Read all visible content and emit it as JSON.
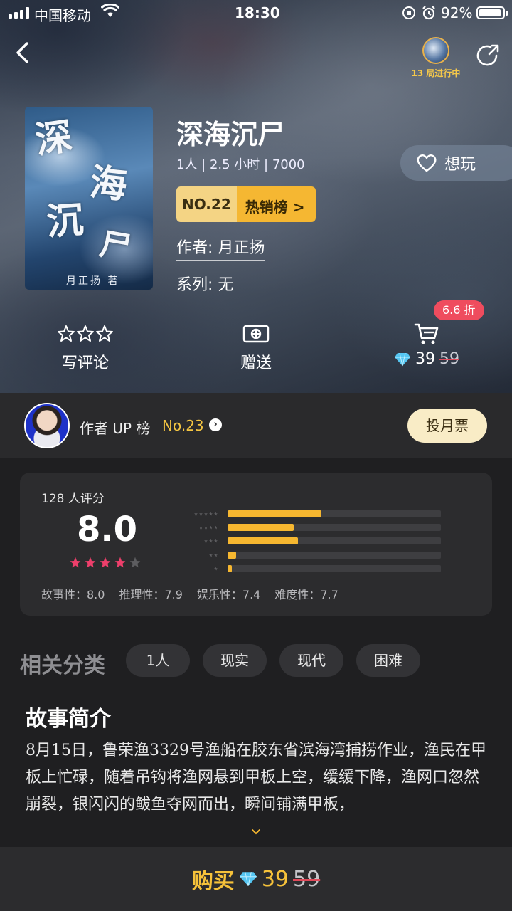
{
  "status_bar": {
    "carrier": "中国移动",
    "time": "18:30",
    "battery": "92%"
  },
  "live": {
    "text": "13 局进行中"
  },
  "game": {
    "title": "深海沉尸",
    "meta": "1人 | 2.5 小时 | 7000",
    "rank_no": "NO.22",
    "rank_label": "热销榜 >",
    "author": "作者: 月正扬",
    "series": "系列: 无",
    "want_label": "想玩",
    "cover_chars": [
      "深",
      "海",
      "沉",
      "尸"
    ],
    "cover_author": "月正扬 著"
  },
  "actions": {
    "review": "写评论",
    "gift": "赠送",
    "discount_badge": "6.6 折",
    "price": "39",
    "original_price": "59"
  },
  "author_up": {
    "label": "作者 UP 榜",
    "rank": "No.23",
    "vote_button": "投月票"
  },
  "rating": {
    "count": "128 人评分",
    "score": "8.0",
    "star_level": 4,
    "distribution": [
      {
        "stars": 5,
        "fraction": 0.44
      },
      {
        "stars": 4,
        "fraction": 0.31
      },
      {
        "stars": 3,
        "fraction": 0.33
      },
      {
        "stars": 2,
        "fraction": 0.04
      },
      {
        "stars": 1,
        "fraction": 0.02
      }
    ],
    "dims": [
      "故事性：8.0",
      "推理性：7.9",
      "娱乐性：7.4",
      "难度性：7.7"
    ]
  },
  "categories": {
    "title": "相关分类",
    "tags": [
      "1人",
      "现实",
      "现代",
      "困难"
    ]
  },
  "intro": {
    "title": "故事简介",
    "text": "8月15日，鲁荣渔3329号渔船在胶东省滨海湾捕捞作业，渔民在甲板上忙碌，随着吊钩将渔网悬到甲板上空，缓缓下降，渔网口忽然崩裂，银闪闪的鲅鱼夺网而出，瞬间铺满甲板，"
  },
  "buy": {
    "label": "购买",
    "price": "39",
    "original_price": "59"
  },
  "colors": {
    "accent": "#f6b730",
    "badge": "#ef4c5e",
    "star_pink": "#ee3f6b"
  }
}
